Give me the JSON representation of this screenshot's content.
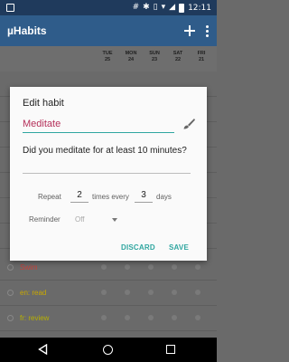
{
  "status_bar": {
    "time": "12:11"
  },
  "app_bar": {
    "title": "µHabits",
    "add_icon": "plus-icon",
    "more_icon": "more-vert-icon"
  },
  "day_header": {
    "days": [
      {
        "dow": "TUE",
        "date": "25"
      },
      {
        "dow": "MON",
        "date": "24"
      },
      {
        "dow": "SUN",
        "date": "23"
      },
      {
        "dow": "SAT",
        "date": "22"
      },
      {
        "dow": "FRI",
        "date": "21"
      }
    ]
  },
  "habits": [
    {
      "name": "Swim",
      "color": "#c7403a"
    },
    {
      "name": "en: read",
      "color": "#c9a800"
    },
    {
      "name": "fr: review",
      "color": "#b8b000"
    }
  ],
  "dialog": {
    "title": "Edit habit",
    "name_value": "Meditate",
    "description_value": "Did you meditate for at least 10 minutes?",
    "repeat_label": "Repeat",
    "repeat_times": "2",
    "times_every_label": "times every",
    "repeat_days": "3",
    "days_label": "days",
    "reminder_label": "Reminder",
    "reminder_value": "Off",
    "discard_label": "DISCARD",
    "save_label": "SAVE"
  },
  "colors": {
    "accent": "#2fa6a0",
    "name_text": "#b5305a",
    "app_bar": "#2f5c8a",
    "status_bar": "#1f3a5c"
  }
}
